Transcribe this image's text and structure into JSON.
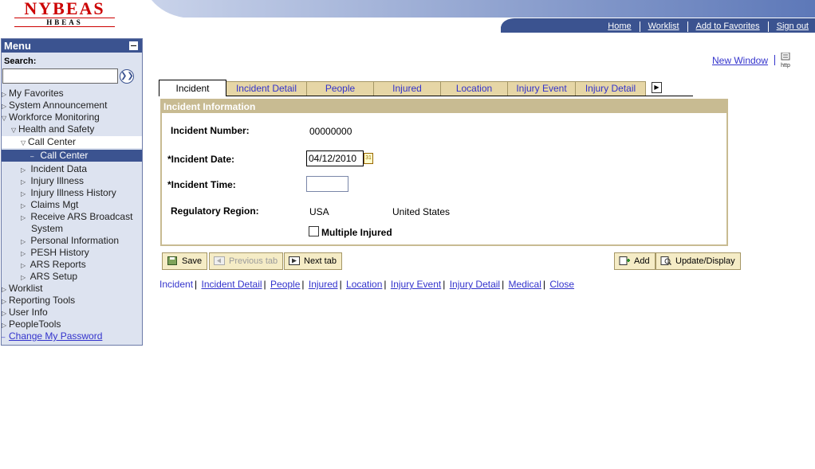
{
  "logo": {
    "main": "NYBEAS",
    "sub": "HBEAS"
  },
  "header_links": [
    "Home",
    "Worklist",
    "Add to Favorites",
    "Sign out"
  ],
  "menu": {
    "title": "Menu",
    "search_label": "Search:",
    "search_value": "",
    "items": [
      "My Favorites",
      "System Announcement",
      "Workforce Monitoring",
      "Health and Safety",
      "Call Center",
      "Call Center",
      "Incident Data",
      "Injury Illness",
      "Injury Illness History",
      "Claims Mgt",
      "Receive ARS Broadcast",
      "System",
      "Personal Information",
      "PESH History",
      "ARS Reports",
      "ARS Setup",
      "Worklist",
      "Reporting Tools",
      "User Info",
      "PeopleTools",
      "Change My Password"
    ]
  },
  "new_window": "New Window",
  "help_icon_text": "http",
  "tabs": [
    "Incident",
    "Incident Detail",
    "People",
    "Injured",
    "Location",
    "Injury Event",
    "Injury Detail"
  ],
  "panel": {
    "title": "Incident Information",
    "incident_number_label": "Incident Number:",
    "incident_number_value": "00000000",
    "incident_date_label": "*Incident Date:",
    "incident_date_value": "04/12/2010",
    "incident_time_label": "*Incident Time:",
    "incident_time_value": "",
    "region_label": "Regulatory Region:",
    "region_code": "USA",
    "region_name": "United States",
    "multiple_injured_label": "Multiple Injured"
  },
  "buttons": {
    "save": "Save",
    "previous_tab": "Previous tab",
    "next_tab": "Next tab",
    "add": "Add",
    "update_display": "Update/Display"
  },
  "bottom_links": [
    "Incident",
    "Incident Detail",
    "People",
    "Injured",
    "Location",
    "Injury Event",
    "Injury Detail",
    "Medical",
    "Close"
  ],
  "colors": {
    "menu_header": "#3b5390",
    "tab": "#e6d6a6",
    "panel_border": "#c8bb92",
    "link": "#3333cc"
  }
}
